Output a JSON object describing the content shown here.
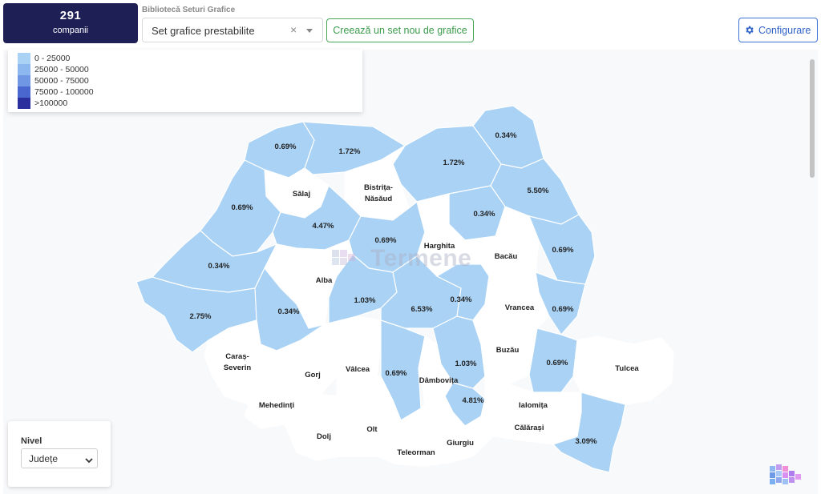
{
  "header": {
    "company_count": "291",
    "company_label": "companii",
    "library_label": "Bibliotecă Seturi Grafice",
    "set_select_value": "Set grafice prestabilite",
    "clear_glyph": "×",
    "new_set_button": "Creează un set nou de grafice",
    "config_button": "Configurare"
  },
  "legend": {
    "items": [
      {
        "label": "0 - 25000",
        "color": "#a9d2f5"
      },
      {
        "label": "25000 - 50000",
        "color": "#8cb8ef"
      },
      {
        "label": "50000 - 75000",
        "color": "#6f97e4"
      },
      {
        "label": "75000 - 100000",
        "color": "#4a66cf"
      },
      {
        "label": ">100000",
        "color": "#2b2f9e"
      }
    ]
  },
  "map": {
    "fill_colors": {
      "data": "#a9d2f5",
      "none": "#ffffff"
    },
    "watermark": "Termene",
    "county_labels": [
      {
        "id": "satu-mare",
        "text": "0.69%"
      },
      {
        "id": "maramures",
        "text": "1.72%"
      },
      {
        "id": "suceava",
        "text": "1.72%"
      },
      {
        "id": "botosani",
        "text": "0.34%"
      },
      {
        "id": "salaj",
        "text": "Sălaj"
      },
      {
        "id": "bistrita-1",
        "text": "Bistrița-"
      },
      {
        "id": "bistrita-2",
        "text": "Năsăud"
      },
      {
        "id": "iasi",
        "text": "5.50%"
      },
      {
        "id": "bihor",
        "text": "0.69%"
      },
      {
        "id": "cluj",
        "text": "4.47%"
      },
      {
        "id": "neamt",
        "text": "0.34%"
      },
      {
        "id": "mures",
        "text": "0.69%"
      },
      {
        "id": "harghita",
        "text": "Harghita"
      },
      {
        "id": "bacau",
        "text": "Bacău"
      },
      {
        "id": "vaslui",
        "text": "0.69%"
      },
      {
        "id": "arad",
        "text": "0.34%"
      },
      {
        "id": "alba",
        "text": "Alba"
      },
      {
        "id": "sibiu",
        "text": "1.03%"
      },
      {
        "id": "brasov",
        "text": "6.53%"
      },
      {
        "id": "covasna",
        "text": "0.34%"
      },
      {
        "id": "vrancea",
        "text": "Vrancea"
      },
      {
        "id": "galati",
        "text": "0.69%"
      },
      {
        "id": "timis",
        "text": "2.75%"
      },
      {
        "id": "hunedoara",
        "text": "0.34%"
      },
      {
        "id": "caras-1",
        "text": "Caraș-"
      },
      {
        "id": "caras-2",
        "text": "Severin"
      },
      {
        "id": "gorj",
        "text": "Gorj"
      },
      {
        "id": "valcea",
        "text": "Vâlcea"
      },
      {
        "id": "arges",
        "text": "0.69%"
      },
      {
        "id": "prahova",
        "text": "1.03%"
      },
      {
        "id": "buzau",
        "text": "Buzău"
      },
      {
        "id": "braila",
        "text": "0.69%"
      },
      {
        "id": "tulcea",
        "text": "Tulcea"
      },
      {
        "id": "dambovita",
        "text": "Dâmbovița"
      },
      {
        "id": "mehedinti",
        "text": "Mehedinți"
      },
      {
        "id": "ilfov",
        "text": "4.81%"
      },
      {
        "id": "ialomita",
        "text": "Ialomița"
      },
      {
        "id": "dolj",
        "text": "Dolj"
      },
      {
        "id": "olt",
        "text": "Olt"
      },
      {
        "id": "calarasi",
        "text": "Călărași"
      },
      {
        "id": "giurgiu",
        "text": "Giurgiu"
      },
      {
        "id": "teleorman",
        "text": "Teleorman"
      },
      {
        "id": "constanta",
        "text": "3.09%"
      }
    ]
  },
  "nivel": {
    "label": "Nivel",
    "selected": "Județe"
  }
}
